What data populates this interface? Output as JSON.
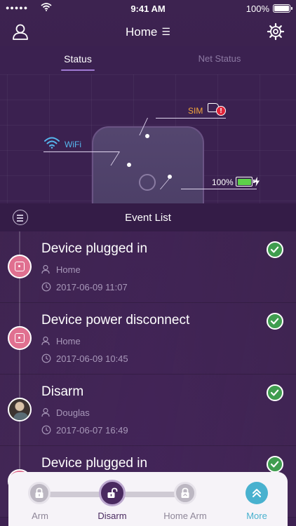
{
  "status_bar": {
    "signal": "●●●●●",
    "time": "9:41 AM",
    "battery_text": "100%"
  },
  "nav": {
    "title": "Home",
    "title_glyph": "☰",
    "left_icon": "user-icon",
    "right_icon": "gear-icon"
  },
  "tabs": [
    {
      "label": "Status",
      "active": true
    },
    {
      "label": "Net Status",
      "active": false
    }
  ],
  "device": {
    "sim_label": "SIM",
    "sim_alert": "!",
    "wifi_label": "WiFi",
    "battery_label": "100%",
    "battery_level": 1.0
  },
  "event_list": {
    "title": "Event List",
    "events": [
      {
        "title": "Device plugged in",
        "user": "Home",
        "time": "2017-06-09 11:07",
        "badge": "plug-icon",
        "status": "ok"
      },
      {
        "title": "Device power disconnect",
        "user": "Home",
        "time": "2017-06-09 10:45",
        "badge": "plug-icon",
        "status": "ok"
      },
      {
        "title": "Disarm",
        "user": "Douglas",
        "time": "2017-06-07 16:49",
        "badge": "avatar",
        "status": "ok"
      },
      {
        "title": "Device plugged in",
        "user": "",
        "time": "",
        "badge": "plug-icon",
        "status": "ok"
      }
    ]
  },
  "controls": {
    "modes": [
      {
        "label": "Arm",
        "active": false
      },
      {
        "label": "Disarm",
        "active": true
      },
      {
        "label": "Home Arm",
        "active": false
      }
    ],
    "more_label": "More"
  },
  "colors": {
    "background": "#3a1f4e",
    "accent": "#a07ad3",
    "sim_orange": "#f4a63c",
    "alert_red": "#e0243a",
    "wifi_blue": "#56b7ee",
    "battery_green": "#5dd149",
    "check_green": "#3f9d4f",
    "more_teal": "#49b1cf"
  }
}
